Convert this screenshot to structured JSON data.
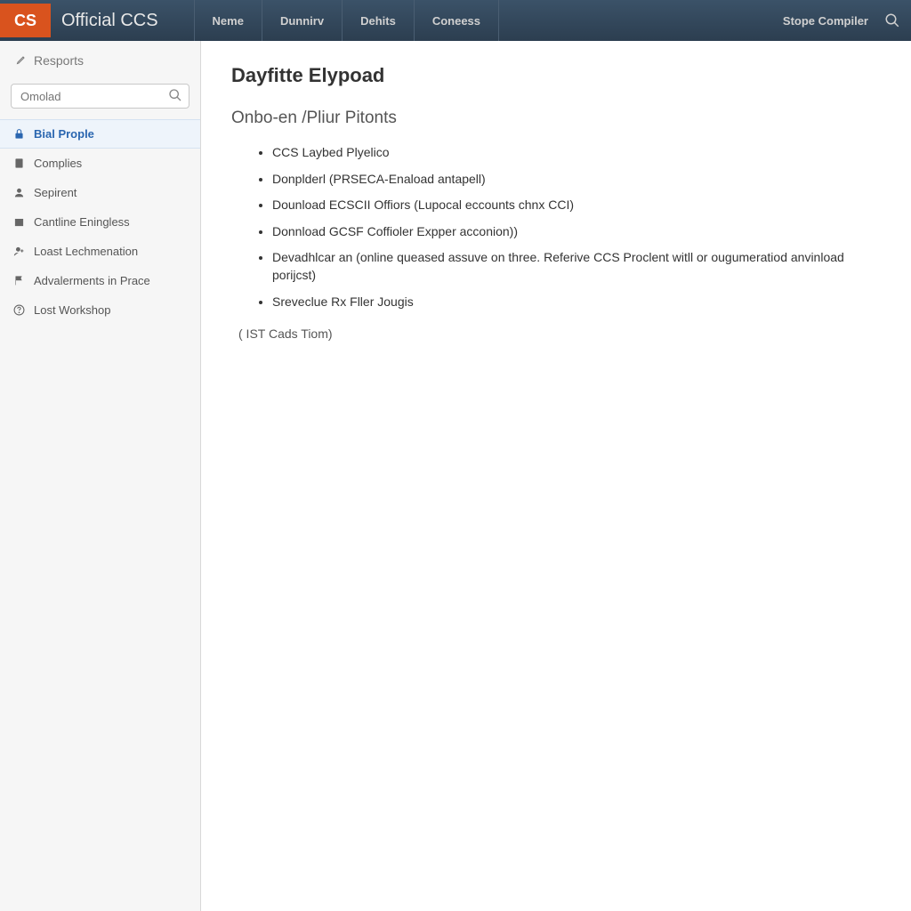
{
  "header": {
    "logo_text": "CS",
    "title": "Official CCS",
    "nav": [
      "Neme",
      "Dunnirv",
      "Dehits",
      "Coneess"
    ],
    "right_link": "Stope Compiler"
  },
  "sidebar": {
    "header": "Resports",
    "search_placeholder": "Omolad",
    "items": [
      {
        "label": "Bial Prople",
        "active": true,
        "icon": "lock"
      },
      {
        "label": "Complies",
        "active": false,
        "icon": "doc"
      },
      {
        "label": "Sepirent",
        "active": false,
        "icon": "person"
      },
      {
        "label": "Cantline Eningless",
        "active": false,
        "icon": "box"
      },
      {
        "label": "Loast Lechmenation",
        "active": false,
        "icon": "user-plus"
      },
      {
        "label": "Advalerments in Prace",
        "active": false,
        "icon": "flag"
      },
      {
        "label": "Lost Workshop",
        "active": false,
        "icon": "question"
      }
    ]
  },
  "main": {
    "title": "Dayfitte Elypoad",
    "section": "Onbo-en /Pliur Pitonts",
    "bullets": [
      "CCS Laybed Plyelico",
      "Donplderl (PRSECA-Enaload antapell)",
      "Dounload ECSCII Offiors (Lupocal eccounts chnx CCI)",
      "Donnload GCSF Coffioler Expper acconion))",
      "Devadhlcar an (online queased assuve on three. Referive CCS Proclent witll or ougumeratiod anvinload porijcst)",
      "Sreveclue Rx Fller Jougis"
    ],
    "footer_note": "( IST Cads Tiom)"
  }
}
